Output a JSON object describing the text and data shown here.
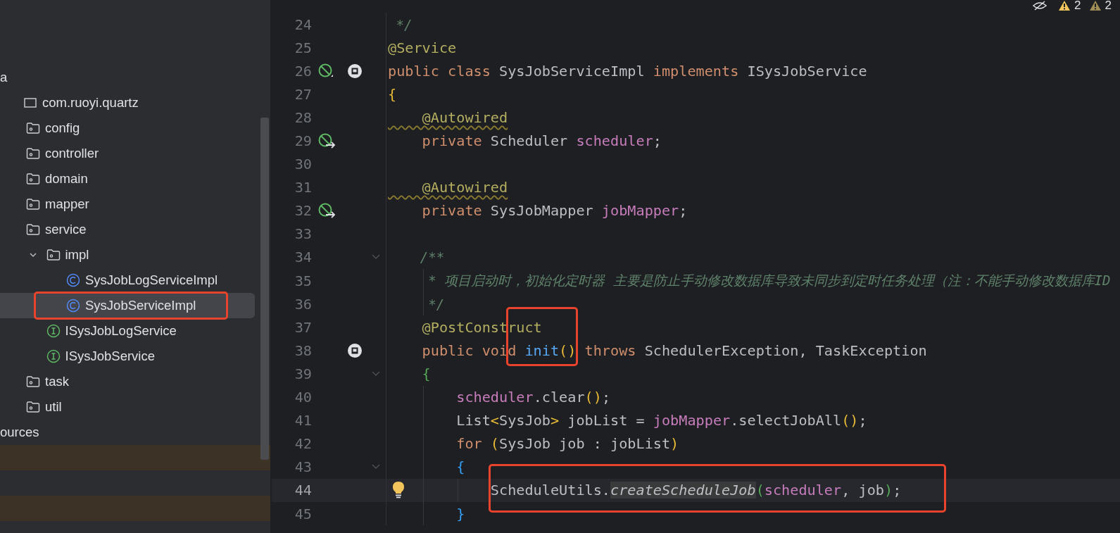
{
  "project_tree": {
    "items": [
      {
        "label": "a",
        "kind": "cut",
        "selected": false,
        "children": [
          {
            "label": "com.ruoyi.quartz",
            "kind": "package",
            "selected": false,
            "children": [
              {
                "label": "config",
                "kind": "folder",
                "selected": false
              },
              {
                "label": "controller",
                "kind": "folder",
                "selected": false
              },
              {
                "label": "domain",
                "kind": "folder",
                "selected": false
              },
              {
                "label": "mapper",
                "kind": "folder",
                "selected": false
              },
              {
                "label": "service",
                "kind": "folder",
                "selected": false,
                "children": [
                  {
                    "label": "impl",
                    "kind": "folder",
                    "expanded": true,
                    "selected": false,
                    "children": [
                      {
                        "label": "SysJobLogServiceImpl",
                        "kind": "class",
                        "selected": false
                      },
                      {
                        "label": "SysJobServiceImpl",
                        "kind": "class",
                        "selected": true
                      }
                    ]
                  },
                  {
                    "label": "ISysJobLogService",
                    "kind": "interface",
                    "selected": false
                  },
                  {
                    "label": "ISysJobService",
                    "kind": "interface",
                    "selected": false
                  }
                ]
              },
              {
                "label": "task",
                "kind": "folder",
                "selected": false
              },
              {
                "label": "util",
                "kind": "folder",
                "selected": false
              }
            ]
          }
        ]
      },
      {
        "label": "ources",
        "kind": "cut",
        "selected": false
      }
    ]
  },
  "editor": {
    "inspections": {
      "warnings": "2",
      "weak_warnings": "2"
    },
    "lines": [
      {
        "number": "24",
        "tokens": [
          {
            "doc": " */"
          }
        ]
      },
      {
        "number": "25",
        "tokens": [
          {
            "ann": "@Service"
          }
        ]
      },
      {
        "number": "26",
        "bean_marker": true,
        "impl_marker": true,
        "tokens": [
          {
            "kw": "public class"
          },
          {
            "p": " SysJobServiceImpl "
          },
          {
            "kw": "implements"
          },
          {
            "p": " ISysJobService"
          }
        ]
      },
      {
        "number": "27",
        "tokens": [
          {
            "y": "{"
          }
        ]
      },
      {
        "number": "28",
        "tokens": [
          {
            "warn": "    @Autowired"
          }
        ]
      },
      {
        "number": "29",
        "inject_marker": true,
        "tokens": [
          {
            "kw": "    private"
          },
          {
            "p": " Scheduler "
          },
          {
            "field": "scheduler"
          },
          {
            "p": ";"
          }
        ]
      },
      {
        "number": "30"
      },
      {
        "number": "31",
        "tokens": [
          {
            "warn": "    @Autowired"
          }
        ]
      },
      {
        "number": "32",
        "inject_marker": true,
        "tokens": [
          {
            "kw": "    private"
          },
          {
            "p": " SysJobMapper "
          },
          {
            "field": "jobMapper"
          },
          {
            "p": ";"
          }
        ]
      },
      {
        "number": "33"
      },
      {
        "number": "34",
        "foldable": true,
        "tokens": [
          {
            "doc": "    /**"
          }
        ]
      },
      {
        "number": "35",
        "tokens": [
          {
            "doc": "     * 项目启动时，初始化定时器 主要是防止手动修改数据库导致未同步到定时任务处理（注：不能手动修改数据库ID"
          }
        ]
      },
      {
        "number": "36",
        "tokens": [
          {
            "doc": "     */"
          }
        ]
      },
      {
        "number": "37",
        "tokens": [
          {
            "ann": "    @PostConstruct"
          }
        ]
      },
      {
        "number": "38",
        "impl_marker": true,
        "tokens": [
          {
            "kw": "    public void "
          },
          {
            "method": "init"
          },
          {
            "y": "()"
          },
          {
            "kw": " throws"
          },
          {
            "p": " SchedulerException, TaskException"
          }
        ]
      },
      {
        "number": "39",
        "foldable": true,
        "tokens": [
          {
            "g": "    {"
          }
        ]
      },
      {
        "number": "40",
        "tokens": [
          {
            "field": "        scheduler"
          },
          {
            "p": ".clear"
          },
          {
            "y": "()"
          },
          {
            "p": ";"
          }
        ]
      },
      {
        "number": "41",
        "tokens": [
          {
            "p": "        List"
          },
          {
            "y": "<"
          },
          {
            "p": "SysJob"
          },
          {
            "y": ">"
          },
          {
            "p": " jobList = "
          },
          {
            "field": "jobMapper"
          },
          {
            "p": ".selectJobAll"
          },
          {
            "y": "()"
          },
          {
            "p": ";"
          }
        ]
      },
      {
        "number": "42",
        "tokens": [
          {
            "kw": "        for "
          },
          {
            "y": "("
          },
          {
            "p": "SysJob job : jobList"
          },
          {
            "y": ")"
          }
        ]
      },
      {
        "number": "43",
        "foldable": true,
        "tokens": [
          {
            "b": "        {"
          }
        ]
      },
      {
        "number": "44",
        "lightbulb": true,
        "current": true,
        "tokens": [
          {
            "p": "            ScheduleUtils."
          },
          {
            "static": "createScheduleJob"
          },
          {
            "g": "("
          },
          {
            "field": "scheduler"
          },
          {
            "p": ", job"
          },
          {
            "g": ")"
          },
          {
            "p": ";"
          }
        ]
      },
      {
        "number": "45",
        "tokens": [
          {
            "b": "        }"
          }
        ]
      }
    ]
  }
}
